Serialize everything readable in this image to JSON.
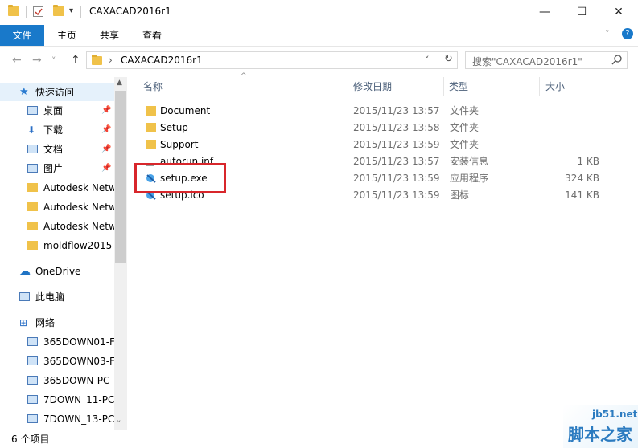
{
  "window": {
    "title": "CAXACAD2016r1",
    "minimize": "—",
    "maximize": "☐",
    "close": "✕"
  },
  "ribbon": {
    "tabs": [
      "文件",
      "主页",
      "共享",
      "查看"
    ]
  },
  "nav": {
    "back": "←",
    "forward": "→",
    "recent": "˅",
    "up": "↑",
    "path_sep": "›",
    "path": "CAXACAD2016r1",
    "dropdown": "˅",
    "refresh": "↻",
    "search_placeholder": "搜索\"CAXACAD2016r1\""
  },
  "sidebar": {
    "items": [
      {
        "label": "快速访问",
        "icon": "star-icon",
        "pinned": false
      },
      {
        "label": "桌面",
        "icon": "desktop-icon",
        "pinned": true
      },
      {
        "label": "下载",
        "icon": "download-icon",
        "pinned": true
      },
      {
        "label": "文档",
        "icon": "document-icon",
        "pinned": true
      },
      {
        "label": "图片",
        "icon": "picture-icon",
        "pinned": true
      },
      {
        "label": "Autodesk Netw",
        "icon": "folder-icon",
        "pinned": false
      },
      {
        "label": "Autodesk Netw",
        "icon": "folder-icon",
        "pinned": false
      },
      {
        "label": "Autodesk Netw",
        "icon": "folder-icon",
        "pinned": false
      },
      {
        "label": "moldflow2015",
        "icon": "folder-icon",
        "pinned": false
      },
      {
        "label": "OneDrive",
        "icon": "cloud-icon",
        "pinned": false
      },
      {
        "label": "此电脑",
        "icon": "computer-icon",
        "pinned": false
      },
      {
        "label": "网络",
        "icon": "network-icon",
        "pinned": false
      },
      {
        "label": "365DOWN01-F",
        "icon": "computer-icon",
        "pinned": false
      },
      {
        "label": "365DOWN03-F",
        "icon": "computer-icon",
        "pinned": false
      },
      {
        "label": "365DOWN-PC",
        "icon": "computer-icon",
        "pinned": false
      },
      {
        "label": "7DOWN_11-PC",
        "icon": "computer-icon",
        "pinned": false
      },
      {
        "label": "7DOWN_13-PC",
        "icon": "computer-icon",
        "pinned": false
      }
    ]
  },
  "columns": {
    "name": "名称",
    "date": "修改日期",
    "type": "类型",
    "size": "大小"
  },
  "files": [
    {
      "name": "Document",
      "date": "2015/11/23 13:57",
      "type": "文件夹",
      "size": "",
      "icon": "folder-icon"
    },
    {
      "name": "Setup",
      "date": "2015/11/23 13:58",
      "type": "文件夹",
      "size": "",
      "icon": "folder-icon"
    },
    {
      "name": "Support",
      "date": "2015/11/23 13:59",
      "type": "文件夹",
      "size": "",
      "icon": "folder-icon"
    },
    {
      "name": "autorun.inf",
      "date": "2015/11/23 13:57",
      "type": "安装信息",
      "size": "1 KB",
      "icon": "file-icon"
    },
    {
      "name": "setup.exe",
      "date": "2015/11/23 13:59",
      "type": "应用程序",
      "size": "324 KB",
      "icon": "exe-icon"
    },
    {
      "name": "setup.ico",
      "date": "2015/11/23 13:59",
      "type": "图标",
      "size": "141 KB",
      "icon": "exe-icon"
    }
  ],
  "status": {
    "count": "6 个项目"
  },
  "watermark": {
    "site": "jb51.net",
    "brand": "脚本之家"
  },
  "colors": {
    "accent": "#1979ca",
    "highlight": "#d8262b",
    "folder": "#f0c24a"
  }
}
